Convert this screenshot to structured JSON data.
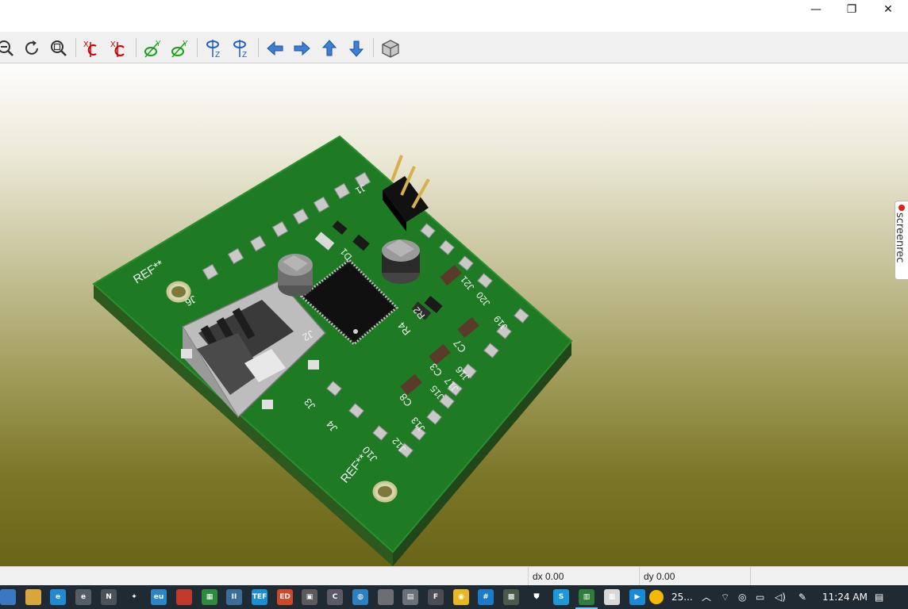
{
  "window": {
    "minimize_glyph": "—",
    "maximize_glyph": "❐",
    "close_glyph": "✕"
  },
  "toolbar": {
    "buttons": [
      {
        "name": "zoom-out-icon"
      },
      {
        "name": "redraw-icon"
      },
      {
        "name": "zoom-fit-icon"
      },
      {
        "name": "rotate-x-cw-icon",
        "label": "X"
      },
      {
        "name": "rotate-x-ccw-icon",
        "label": "X"
      },
      {
        "name": "rotate-y-cw-icon",
        "label": "Y"
      },
      {
        "name": "rotate-y-ccw-icon",
        "label": "Y"
      },
      {
        "name": "rotate-z-cw-icon",
        "label": "Z"
      },
      {
        "name": "rotate-z-ccw-icon",
        "label": "Z"
      },
      {
        "name": "pan-left-icon"
      },
      {
        "name": "pan-right-icon"
      },
      {
        "name": "pan-up-icon"
      },
      {
        "name": "pan-down-icon"
      },
      {
        "name": "orthographic-cube-icon"
      }
    ]
  },
  "board": {
    "silkscreen": {
      "ref_top": "REF**",
      "ref_bottom": "REF**",
      "j1": "J1",
      "j2": "J2",
      "j3": "J3",
      "j4": "J4",
      "j6": "J6",
      "j10": "J10",
      "j12": "J12",
      "j13": "J13",
      "j15": "J15",
      "j16": "J16",
      "j17": "J17",
      "j19": "J19",
      "j20": "J20",
      "j21": "J21",
      "r4": "R4",
      "c3": "C3",
      "c7": "C7",
      "c8": "C8",
      "d1": "D1",
      "r2": "R2"
    }
  },
  "screenrec": {
    "label": "screenrec"
  },
  "status": {
    "dx": "dx 0.00",
    "dy": "dy 0.00"
  },
  "taskbar": {
    "weather": "25...",
    "time": "11:24 AM",
    "apps": [
      {
        "name": "file-manager-icon",
        "color": "#3a78c2",
        "label": ""
      },
      {
        "name": "file-explorer-icon",
        "color": "#d8a63a",
        "label": ""
      },
      {
        "name": "edge-browser-icon",
        "color": "#1f8ad2",
        "label": "e"
      },
      {
        "name": "app-e-icon",
        "color": "#555d66",
        "label": "e"
      },
      {
        "name": "notepad-icon",
        "color": "#4b5259",
        "label": "N"
      },
      {
        "name": "red-arrow-app-icon",
        "color": "#1f2a33",
        "label": "✦"
      },
      {
        "name": "pcb-calculator-icon",
        "color": "#2a86c8",
        "label": "eu"
      },
      {
        "name": "red-app-icon",
        "color": "#c0392b",
        "label": ""
      },
      {
        "name": "kicad-pcbnew-icon",
        "color": "#2e8b3e",
        "label": "▦"
      },
      {
        "name": "app-ii-icon",
        "color": "#3a6e9a",
        "label": "II"
      },
      {
        "name": "tef-app-icon",
        "color": "#1a8fd8",
        "label": "TEF"
      },
      {
        "name": "ed-app-icon",
        "color": "#d2462a",
        "label": "ED"
      },
      {
        "name": "gallery-icon",
        "color": "#5b5b5b",
        "label": "▣"
      },
      {
        "name": "settings-app-icon",
        "color": "#5a5a68",
        "label": "C"
      },
      {
        "name": "globe-app-icon",
        "color": "#2a80c0",
        "label": "◍"
      },
      {
        "name": "grey-app-icon",
        "color": "#6b6e73",
        "label": ""
      },
      {
        "name": "document-app-icon",
        "color": "#6c7078",
        "label": "▤"
      },
      {
        "name": "f-app-icon",
        "color": "#4a4e54",
        "label": "F"
      },
      {
        "name": "chrome-icon",
        "color": "#e8b820",
        "label": "◉"
      },
      {
        "name": "kicad-board-icon",
        "color": "#1a7bc8",
        "label": "#"
      },
      {
        "name": "photo-app-icon",
        "color": "#4a5a4a",
        "label": "▩"
      },
      {
        "name": "security-icon",
        "color": "#1f2a33",
        "label": "⛊"
      },
      {
        "name": "skype-icon",
        "color": "#1a9ad8",
        "label": "S"
      },
      {
        "name": "kicad-3d-viewer-icon",
        "color": "#2e7d3a",
        "label": "▥"
      },
      {
        "name": "calendar-app-icon",
        "color": "#d8d8d8",
        "label": "▦"
      },
      {
        "name": "screen-recorder-icon",
        "color": "#1a8ad8",
        "label": "▶"
      }
    ]
  }
}
